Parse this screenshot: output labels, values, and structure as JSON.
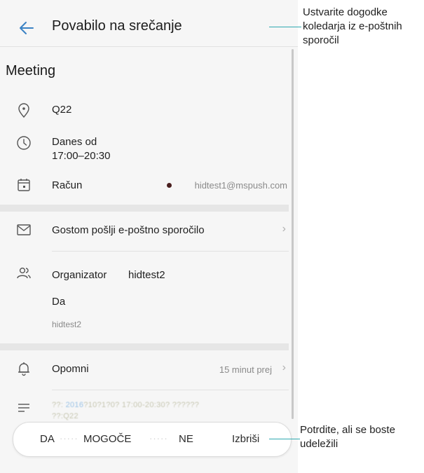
{
  "header": {
    "title": "Povabilo na srečanje"
  },
  "event": {
    "title": "Meeting"
  },
  "details": {
    "location": "Q22",
    "time_line1": "Danes od",
    "time_line2": "17:00–20:30",
    "calendar_label": "Račun",
    "calendar_account": "hidtest1@mspush.com",
    "calendar_dot_color": "#4a1f1f"
  },
  "email_guests": {
    "label": "Gostom pošlji e-poštno sporočilo"
  },
  "organizer": {
    "label": "Organizator",
    "name": "hidtest2",
    "response": "Da",
    "attendee": "hidtest2"
  },
  "reminder": {
    "label": "Opomni",
    "value": "15 minut prej"
  },
  "notes": {
    "line1_a": "??:",
    "line1_b": "2016",
    "line1_c": "?10?1?0? 17:00-20:30? ??????",
    "line2": "??:Q22"
  },
  "actions": {
    "yes": "DA",
    "maybe": "MOGOČE",
    "no": "NE",
    "delete": "Izbriši"
  },
  "callouts": {
    "top": [
      "Ustvarite dogodke",
      "koledarja iz e-poštnih",
      "sporočil"
    ],
    "bottom": [
      "Potrdite, ali se boste",
      "udeležili"
    ]
  },
  "colors": {
    "accent": "#3b82c4",
    "callout_line": "#2fa9b0"
  }
}
